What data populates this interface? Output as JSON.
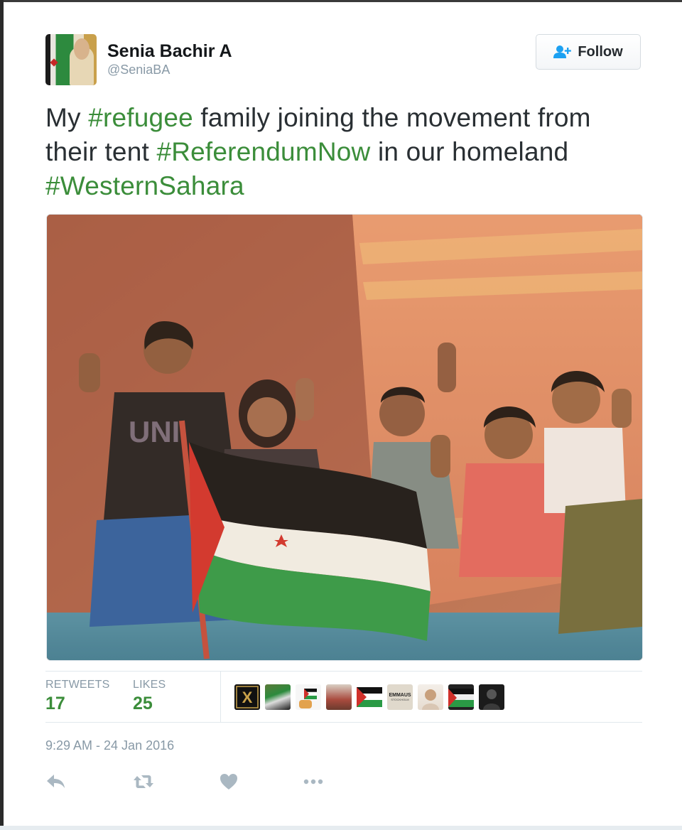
{
  "user": {
    "name": "Senia Bachir A",
    "handle": "@SeniaBA"
  },
  "follow_button": {
    "label": "Follow",
    "icon": "follow-person-plus-icon"
  },
  "tweet": {
    "segments": [
      {
        "text": "My ",
        "type": "text"
      },
      {
        "text": "#refugee",
        "type": "hashtag"
      },
      {
        "text": " family joining the movement from their tent ",
        "type": "text"
      },
      {
        "text": "#ReferendumNow",
        "type": "hashtag"
      },
      {
        "text": " in our homeland ",
        "type": "text"
      },
      {
        "text": "#WesternSahara",
        "type": "hashtag"
      }
    ]
  },
  "stats": {
    "retweets_label": "RETWEETS",
    "retweets_value": "17",
    "likes_label": "LIKES",
    "likes_value": "25"
  },
  "timestamp": "9:29 AM - 24 Jan 2016",
  "likers": [
    {
      "icon": "liker-avatar-x-logo",
      "label": "X"
    },
    {
      "icon": "liker-avatar-flag"
    },
    {
      "icon": "liker-avatar-flag-hand"
    },
    {
      "icon": "liker-avatar-photo"
    },
    {
      "icon": "liker-avatar-flag"
    },
    {
      "icon": "liker-avatar-emmaus",
      "label": "EMMAUS",
      "sublabel": "STOCKHOLM"
    },
    {
      "icon": "liker-avatar-portrait"
    },
    {
      "icon": "liker-avatar-flag"
    },
    {
      "icon": "liker-avatar-portrait-dark"
    }
  ],
  "actions": [
    {
      "name": "reply",
      "icon": "reply-icon"
    },
    {
      "name": "retweet",
      "icon": "retweet-icon"
    },
    {
      "name": "like",
      "icon": "heart-icon"
    },
    {
      "name": "more",
      "icon": "more-dots-icon"
    }
  ],
  "colors": {
    "hashtag": "#3b8d3a",
    "stat_value": "#3b8d3a",
    "muted": "#8899a6",
    "text": "#292f33",
    "action_icon": "#aab8c2",
    "follow_icon": "#1da1f2"
  }
}
